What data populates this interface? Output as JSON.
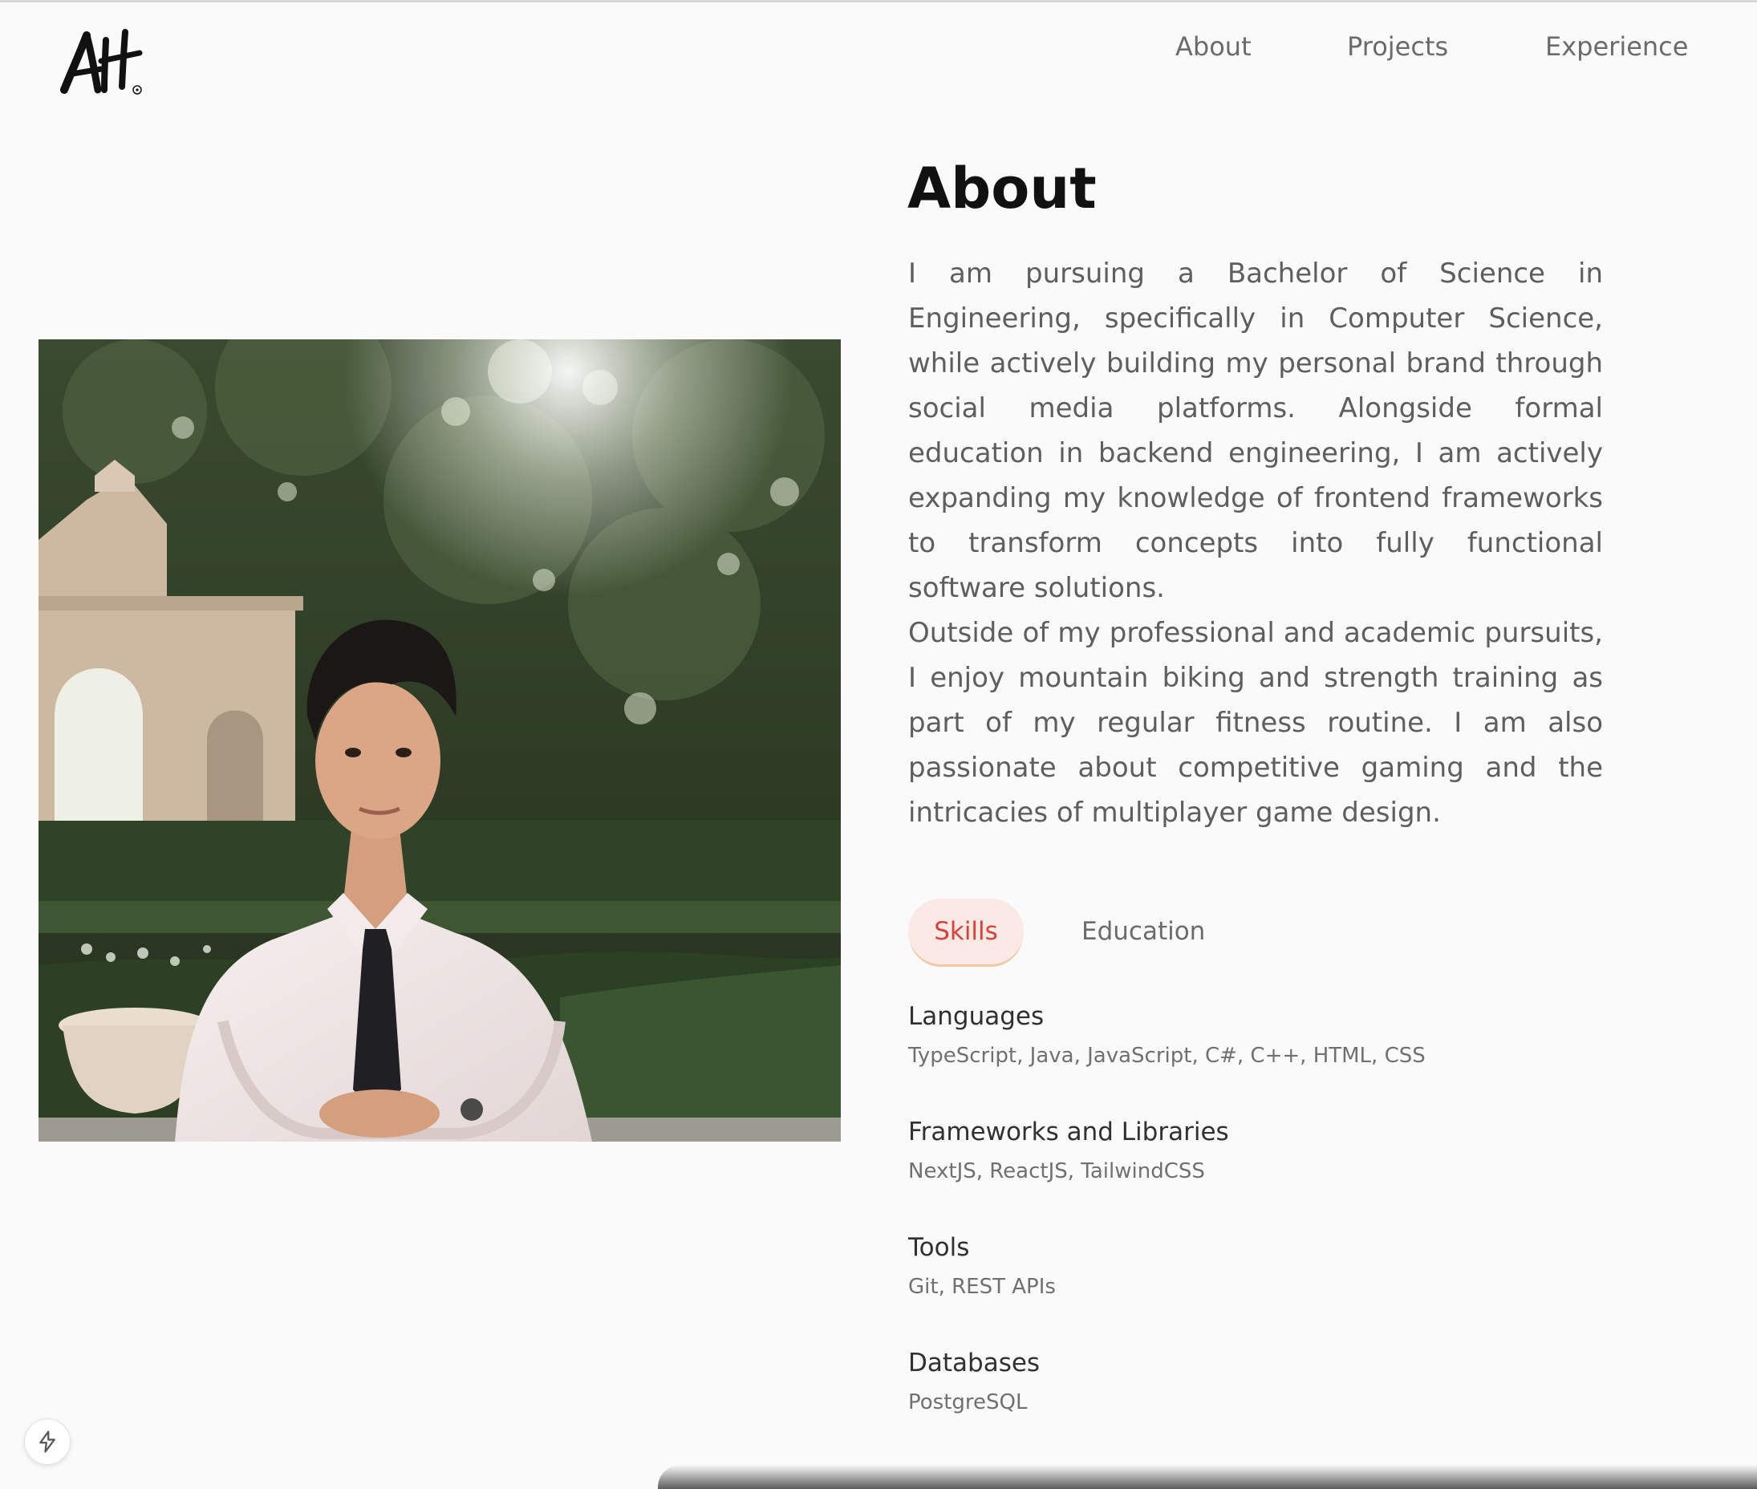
{
  "header": {
    "logo_alt": "AH",
    "nav": {
      "about": "About",
      "projects": "Projects",
      "experience": "Experience"
    }
  },
  "about": {
    "title": "About",
    "paragraphs": [
      "I am pursuing a Bachelor of Science in Engineering, specifically in Computer Science, while actively building my personal brand through social media platforms. Alongside formal education in backend engineering, I am actively expanding my knowledge of frontend frameworks to transform concepts into fully functional software solutions.",
      "Outside of my professional and academic pursuits, I enjoy mountain biking and strength training as part of my regular fitness routine. I am also passionate about competitive gaming and the intricacies of multiplayer game design."
    ],
    "tabs": {
      "skills": "Skills",
      "education": "Education",
      "active": "Skills"
    },
    "skills": [
      {
        "heading": "Languages",
        "value": "TypeScript, Java, JavaScript, C#, C++, HTML, CSS"
      },
      {
        "heading": "Frameworks and Libraries",
        "value": "NextJS, ReactJS, TailwindCSS"
      },
      {
        "heading": "Tools",
        "value": "Git, REST APIs"
      },
      {
        "heading": "Databases",
        "value": "PostgreSQL"
      }
    ]
  },
  "badge": {
    "icon": "lightning-bolt-icon"
  },
  "colors": {
    "background": "#fafafa",
    "active_tab_text": "#d9423a",
    "active_tab_bg": "#fbe9e6",
    "body_text": "#5e5e5e"
  }
}
